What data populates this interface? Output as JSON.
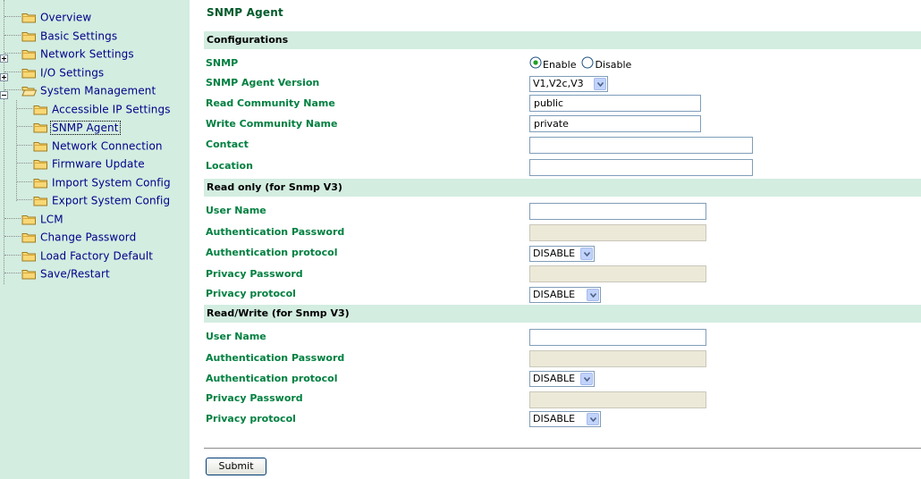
{
  "sidebar": {
    "items": [
      {
        "label": "Overview",
        "depth": 0
      },
      {
        "label": "Basic Settings",
        "depth": 0
      },
      {
        "label": "Network Settings",
        "depth": 0,
        "expander": "plus"
      },
      {
        "label": "I/O Settings",
        "depth": 0,
        "expander": "plus"
      },
      {
        "label": "System Management",
        "depth": 0,
        "expander": "minus",
        "open": true
      },
      {
        "label": "Accessible IP Settings",
        "depth": 1
      },
      {
        "label": "SNMP Agent",
        "depth": 1,
        "selected": true
      },
      {
        "label": "Network Connection",
        "depth": 1
      },
      {
        "label": "Firmware Update",
        "depth": 1
      },
      {
        "label": "Import System Config",
        "depth": 1
      },
      {
        "label": "Export System Config",
        "depth": 1
      },
      {
        "label": "LCM",
        "depth": 0
      },
      {
        "label": "Change Password",
        "depth": 0
      },
      {
        "label": "Load Factory Default",
        "depth": 0
      },
      {
        "label": "Save/Restart",
        "depth": 0
      }
    ]
  },
  "page": {
    "title": "SNMP Agent",
    "sections": {
      "configurations": "Configurations",
      "read_only": "Read only (for Snmp V3)",
      "read_write": "Read/Write (for Snmp V3)"
    },
    "config": {
      "snmp_label": "SNMP",
      "enable_label": "Enable",
      "disable_label": "Disable",
      "snmp_selected": "Enable",
      "version_label": "SNMP Agent Version",
      "version_value": "V1,V2c,V3",
      "read_community_label": "Read Community Name",
      "read_community_value": "public",
      "write_community_label": "Write Community Name",
      "write_community_value": "private",
      "contact_label": "Contact",
      "contact_value": "",
      "location_label": "Location",
      "location_value": ""
    },
    "read_only": {
      "user_name_label": "User Name",
      "user_name_value": "",
      "auth_password_label": "Authentication Password",
      "auth_protocol_label": "Authentication protocol",
      "auth_protocol_value": "DISABLE",
      "privacy_password_label": "Privacy Password",
      "privacy_protocol_label": "Privacy protocol",
      "privacy_protocol_value": "DISABLE"
    },
    "read_write": {
      "user_name_label": "User Name",
      "user_name_value": "",
      "auth_password_label": "Authentication Password",
      "auth_protocol_label": "Authentication protocol",
      "auth_protocol_value": "DISABLE",
      "privacy_password_label": "Privacy Password",
      "privacy_protocol_label": "Privacy protocol",
      "privacy_protocol_value": "DISABLE"
    },
    "submit_label": "Submit"
  },
  "colors": {
    "sidebar_bg": "#d3ede1",
    "section_bg": "#d3ede1",
    "label_green": "#008040",
    "title_green": "#005a2a",
    "nav_link": "#000088"
  },
  "icons": {
    "tree_folder": "folder-icon",
    "tree_open_folder": "folder-open-icon",
    "expander_plus": "plus-box-icon",
    "expander_minus": "minus-box-icon",
    "dropdown": "chevron-down-icon",
    "radio": "radio-icon"
  }
}
